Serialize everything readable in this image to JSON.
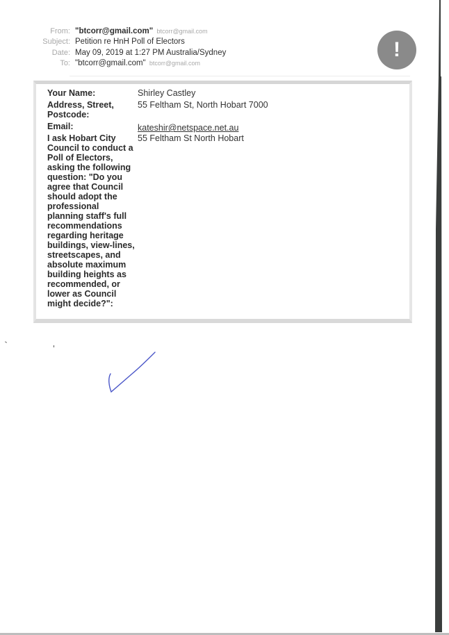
{
  "email_header": {
    "from": {
      "label": "From:",
      "name": "\"btcorr@gmail.com\"",
      "address": "btcorr@gmail.com"
    },
    "subject": {
      "label": "Subject:",
      "value": "Petition re HnH Poll of Electors"
    },
    "date": {
      "label": "Date:",
      "value": "May 09, 2019 at 1:27 PM Australia/Sydney"
    },
    "to": {
      "label": "To:",
      "name": "\"btcorr@gmail.com\"",
      "address": "btcorr@gmail.com"
    },
    "importance_icon": "!"
  },
  "form": {
    "rows": [
      {
        "label": "Your Name:",
        "value": "Shirley Castley"
      },
      {
        "label": "Address, Street, Postcode:",
        "value": "55 Feltham St, North Hobart 7000"
      },
      {
        "label": "Email:",
        "value": "kateshir@netspace.net.au"
      },
      {
        "label": "I ask Hobart City Council to conduct a Poll of Electors, asking the following question: \"Do you agree that Council should adopt the professional planning staff's full recommendations regarding heritage buildings, view-lines, streetscapes, and absolute maximum building heights as recommended, or lower as Council might decide?\":",
        "value": "55 Feltham St North Hobart"
      }
    ]
  },
  "annotation": {
    "signature_color": "#4a56c8"
  }
}
